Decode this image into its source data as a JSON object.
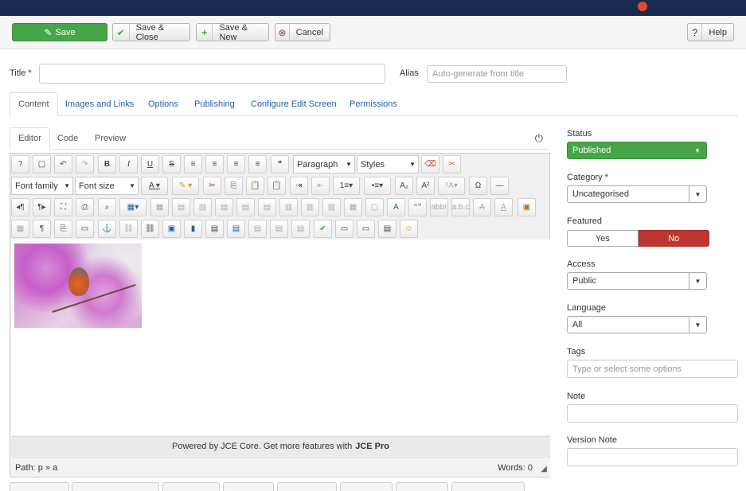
{
  "toolbar": {
    "save": "Save",
    "save_close": "Save & Close",
    "save_new": "Save & New",
    "cancel": "Cancel",
    "help": "Help"
  },
  "fields": {
    "title_label": "Title *",
    "title_value": "",
    "alias_label": "Alias",
    "alias_placeholder": "Auto-generate from title"
  },
  "tabs": [
    "Content",
    "Images and Links",
    "Options",
    "Publishing",
    "Configure Edit Screen",
    "Permissions"
  ],
  "editor_tabs": [
    "Editor",
    "Code",
    "Preview"
  ],
  "editor": {
    "format_select": "Paragraph",
    "styles_select": "Styles",
    "font_family": "Font family",
    "font_size": "Font size",
    "powered_text": "Powered by JCE Core. Get more features with",
    "powered_link": "JCE Pro",
    "path": "Path: p » a",
    "words": "Words: 0"
  },
  "sidebar": {
    "status_label": "Status",
    "status_value": "Published",
    "category_label": "Category *",
    "category_value": "Uncategorised",
    "featured_label": "Featured",
    "featured_yes": "Yes",
    "featured_no": "No",
    "access_label": "Access",
    "access_value": "Public",
    "language_label": "Language",
    "language_value": "All",
    "tags_label": "Tags",
    "tags_placeholder": "Type or select some options",
    "note_label": "Note",
    "note_value": "",
    "version_note_label": "Version Note",
    "version_note_value": ""
  },
  "colors": {
    "save_green": "#46a546",
    "no_red": "#bd362f",
    "link_blue": "#1f61a8",
    "topbar": "#1a2a4f"
  }
}
